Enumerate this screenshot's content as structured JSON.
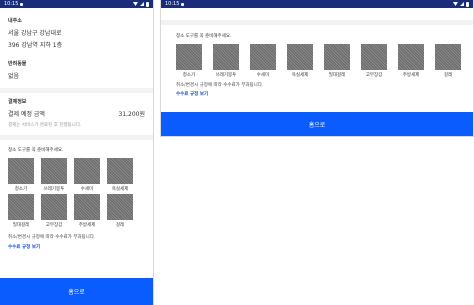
{
  "status": {
    "time": "10:15"
  },
  "address": {
    "heading": "내주소",
    "line1": "서울 강남구 강남대로",
    "line2": "396 강남역 지하 1층"
  },
  "pet": {
    "heading": "반려동물",
    "value": "없음"
  },
  "payment": {
    "heading": "결제정보",
    "label": "결제 예정 금액",
    "amount": "31,200원",
    "note": "결제는 서비스가 완료된 후 진행됩니다."
  },
  "tools": {
    "intro": "청소 도구를 꼭 준비해주세요.",
    "items": [
      "청소기",
      "쓰레기봉투",
      "수세미",
      "욕실세제",
      "밀대걸레",
      "고무장갑",
      "주방세제",
      "걸레"
    ]
  },
  "fee": {
    "note": "취소/변경시 규정에 따라 수수료가 부과됩니다.",
    "link": "수수료 규정 보기"
  },
  "cta": {
    "label": "홈으로"
  }
}
